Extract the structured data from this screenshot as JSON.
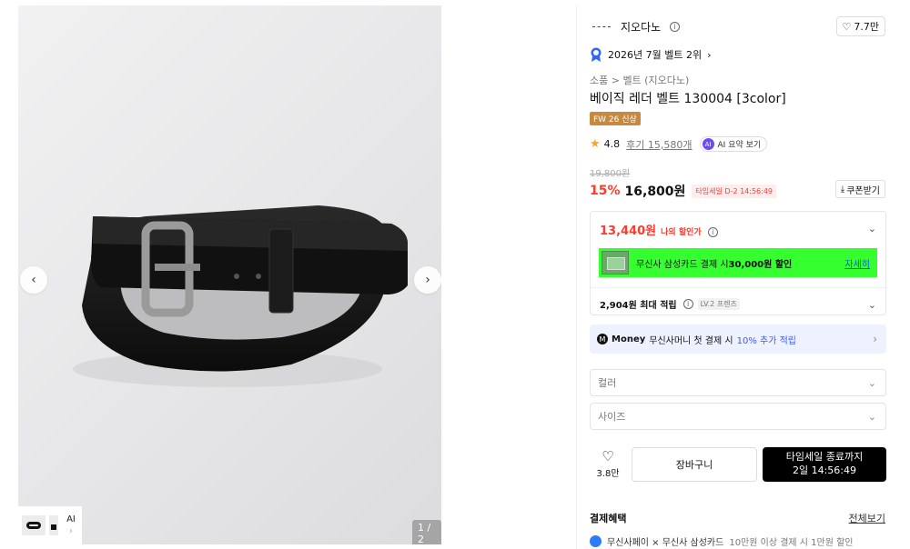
{
  "gallery": {
    "counter": "1 / 2",
    "ai_label": "AI",
    "prev_icon": "chevron-left-icon",
    "next_icon": "chevron-right-icon",
    "expand_icon": "expand-icon"
  },
  "brand": {
    "name": "지오다노",
    "likes": "7.7만"
  },
  "rank": "2026년 7월 벨트 2위",
  "breadcrumb": "소품 > 벨트 (지오다노)",
  "product": {
    "title": "베이직 레더 벨트 130004 [3color]",
    "tag": "FW 26 신상",
    "rating": "4.8",
    "reviews": "후기 15,580개",
    "ai_summary": "AI 요약 보기",
    "ai_badge": "AI",
    "original_price": "19,800원",
    "discount": "15%",
    "price": "16,800원",
    "timesale": "타임세일 D-2 14:56:49",
    "coupon": "쿠폰받기"
  },
  "benefit": {
    "my_price": "13,440원",
    "my_price_label": "나의 할인가",
    "card_text_prefix": "무신사 삼성카드 결제 시 ",
    "card_text_bold": "30,000원 할인",
    "card_detail": "자세히",
    "points": "2,904원 최대 적립",
    "level": "LV.2 프렌즈"
  },
  "money_banner": {
    "brand": "Money",
    "text": "무신사머니 첫 결제 시",
    "highlight": "10% 추가 적립"
  },
  "options": {
    "color_placeholder": "컬러",
    "size_placeholder": "사이즈"
  },
  "actions": {
    "wish_count": "3.8만",
    "cart": "장바구니",
    "buy_line1": "타임세일 종료까지",
    "buy_line2": "2일 14:56:49"
  },
  "payment": {
    "title": "결제혜택",
    "see_all": "전체보기",
    "row_main": "무신사페이 × 무신사 삼성카드",
    "row_muted": "10만원 이상 결제 시 1만원 할인"
  },
  "colors": {
    "accent_red": "#ff3b30",
    "card_banner_green": "#35ff2e",
    "tag_brown": "#c8893e",
    "ai_purple": "#6b4cf6",
    "money_bg": "#eef2ff"
  }
}
